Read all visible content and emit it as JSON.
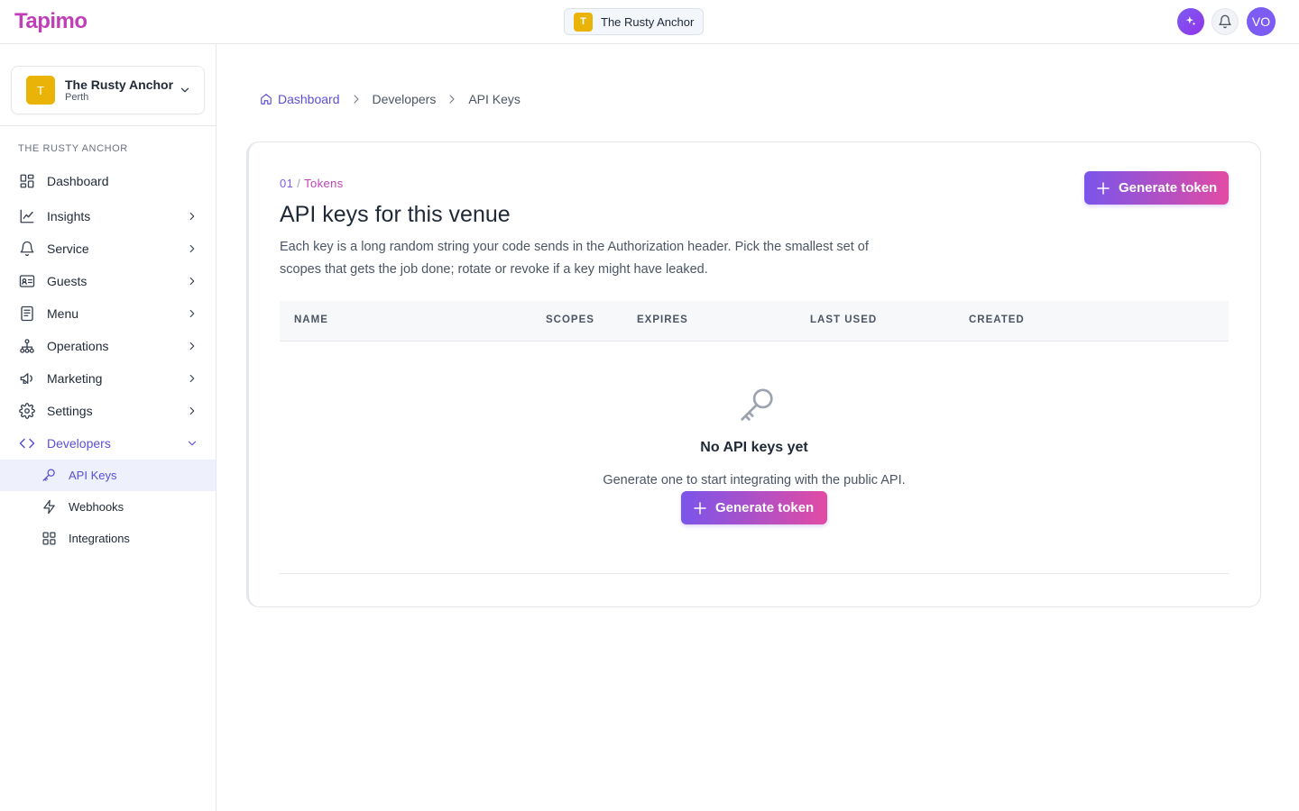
{
  "app": {
    "logo_text": "Tapimo",
    "venue_initial": "T",
    "venue_name": "The Rusty Anchor",
    "avatar_initials": "VO",
    "accent_color": "#7c5cf3",
    "brand_color": "#c03fb6"
  },
  "sidebar": {
    "venue_name": "The Rusty Anchor",
    "venue_city": "Perth",
    "venue_initial": "T",
    "section_label": "THE RUSTY ANCHOR",
    "items": [
      {
        "label": "Dashboard",
        "icon": "dashboard-icon"
      },
      {
        "label": "Insights",
        "icon": "chart-line-icon"
      },
      {
        "label": "Service",
        "icon": "bell-icon"
      },
      {
        "label": "Guests",
        "icon": "id-card-icon"
      },
      {
        "label": "Menu",
        "icon": "menu-list-icon"
      },
      {
        "label": "Operations",
        "icon": "hierarchy-icon"
      },
      {
        "label": "Marketing",
        "icon": "megaphone-icon"
      },
      {
        "label": "Settings",
        "icon": "gear-icon"
      },
      {
        "label": "Developers",
        "icon": "code-icon"
      }
    ],
    "sub_items": [
      {
        "label": "API Keys",
        "icon": "key-icon",
        "active": true
      },
      {
        "label": "Webhooks",
        "icon": "lightning-icon"
      },
      {
        "label": "Integrations",
        "icon": "grid-icon"
      }
    ]
  },
  "breadcrumb": {
    "home": "Dashboard",
    "middle": "Developers",
    "current": "API Keys"
  },
  "main": {
    "eyebrow_num": "01",
    "eyebrow_sep": "/",
    "eyebrow_word": "Tokens",
    "title": "API keys for this venue",
    "description": "Each key is a long random string your code sends in the Authorization header. Pick the smallest set of scopes that gets the job done; rotate or revoke if a key might have leaked.",
    "generate_label": "Generate token",
    "columns": [
      "NAME",
      "SCOPES",
      "EXPIRES",
      "LAST USED",
      "CREATED"
    ],
    "empty_title": "No API keys yet",
    "empty_subtitle": "Generate one to start integrating with the public API."
  }
}
